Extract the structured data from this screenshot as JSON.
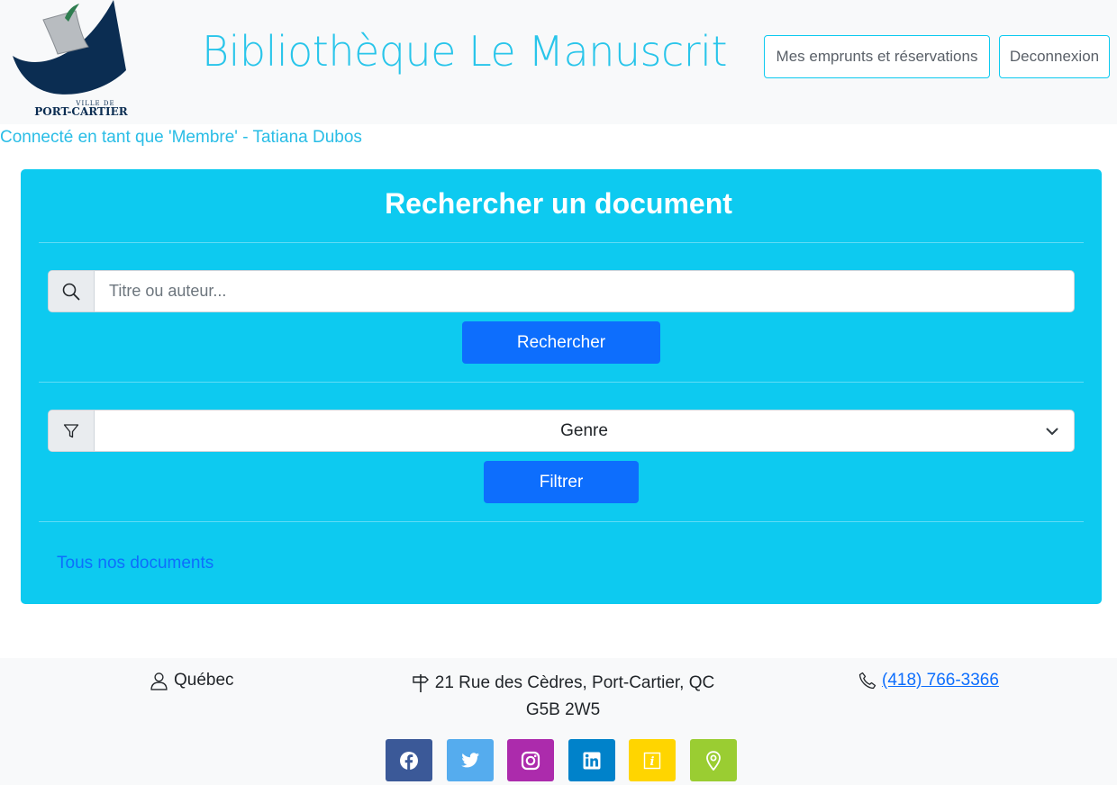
{
  "header": {
    "logo_text_small": "VILLE DE",
    "logo_text_big": "PORT-CARTIER",
    "title": "Bibliothèque Le Manuscrit",
    "loans_button": "Mes emprunts et réservations",
    "logout_button": "Deconnexion"
  },
  "session": {
    "connected_as": "Connecté en tant que 'Membre' - Tatiana Dubos"
  },
  "search_card": {
    "title": "Rechercher un document",
    "search_placeholder": "Titre ou auteur...",
    "search_button": "Rechercher",
    "genre_select_value": "Genre",
    "filter_button": "Filtrer",
    "all_docs_link": "Tous nos documents"
  },
  "footer": {
    "region": "Québec",
    "address_line1": "21 Rue des Cèdres, Port-Cartier, QC",
    "address_line2": "G5B 2W5",
    "phone": "(418) 766-3366",
    "social": [
      {
        "icon": "facebook-icon",
        "color": "#3b5998"
      },
      {
        "icon": "twitter-icon",
        "color": "#55acee"
      },
      {
        "icon": "instagram-icon",
        "color": "#ac2bac"
      },
      {
        "icon": "linkedin-icon",
        "color": "#0082ca"
      },
      {
        "icon": "info-icon",
        "color": "#ffd500"
      },
      {
        "icon": "map-pin-icon",
        "color": "#9acd32"
      }
    ]
  },
  "colors": {
    "accent": "#0dcaf0",
    "primary": "#0d6efd",
    "title": "#29c5ea",
    "logo_navy": "#0b2d52"
  }
}
